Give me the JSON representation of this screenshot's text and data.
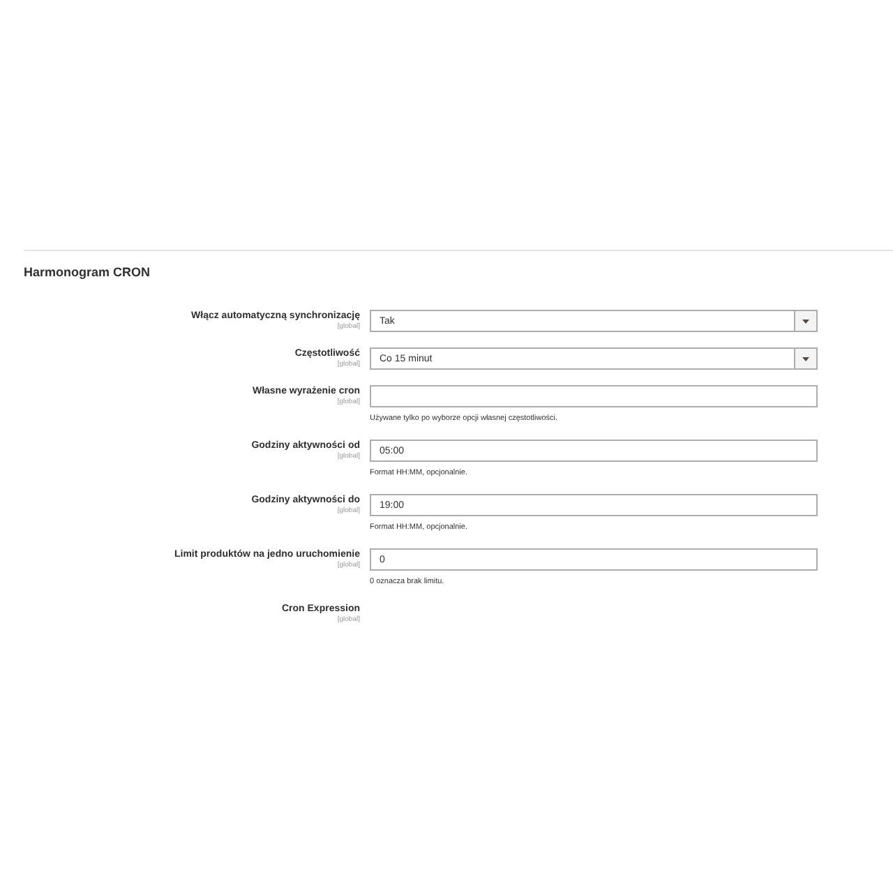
{
  "section": {
    "title": "Harmonogram CRON"
  },
  "fields": [
    {
      "kind": "select",
      "label": "Włącz automatyczną synchronizację",
      "scope": "[global]",
      "value": "Tak"
    },
    {
      "kind": "select",
      "label": "Częstotliwość",
      "scope": "[global]",
      "value": "Co 15 minut"
    },
    {
      "kind": "text",
      "label": "Własne wyrażenie cron",
      "scope": "[global]",
      "note": "Używane tylko po wyborze opcji własnej częstotliwości."
    },
    {
      "kind": "text",
      "label": "Godziny aktywności od",
      "scope": "[global]",
      "value": "05:00",
      "note": "Format HH:MM, opcjonalnie."
    },
    {
      "kind": "text",
      "label": "Godziny aktywności do",
      "scope": "[global]",
      "value": "19:00",
      "note": "Format HH:MM, opcjonalnie."
    },
    {
      "kind": "text",
      "label": "Limit produktów na jedno uruchomienie",
      "scope": "[global]",
      "value": "0",
      "note": "0 oznacza brak limitu."
    },
    {
      "kind": "static",
      "label": "Cron Expression",
      "scope": "[global]"
    }
  ]
}
